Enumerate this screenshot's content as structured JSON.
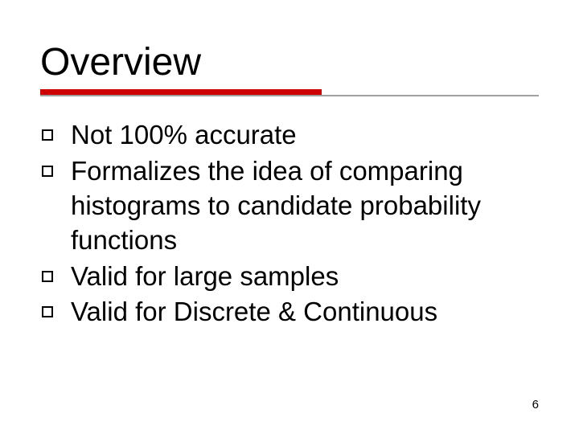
{
  "slide": {
    "title": "Overview",
    "bullets": [
      "Not 100% accurate",
      "Formalizes the idea of comparing histograms to candidate probability functions",
      "Valid for large samples",
      "Valid for Discrete & Continuous"
    ],
    "page_number": "6"
  },
  "colors": {
    "accent": "#cc0000",
    "underline_gray": "#a0a0a0"
  }
}
